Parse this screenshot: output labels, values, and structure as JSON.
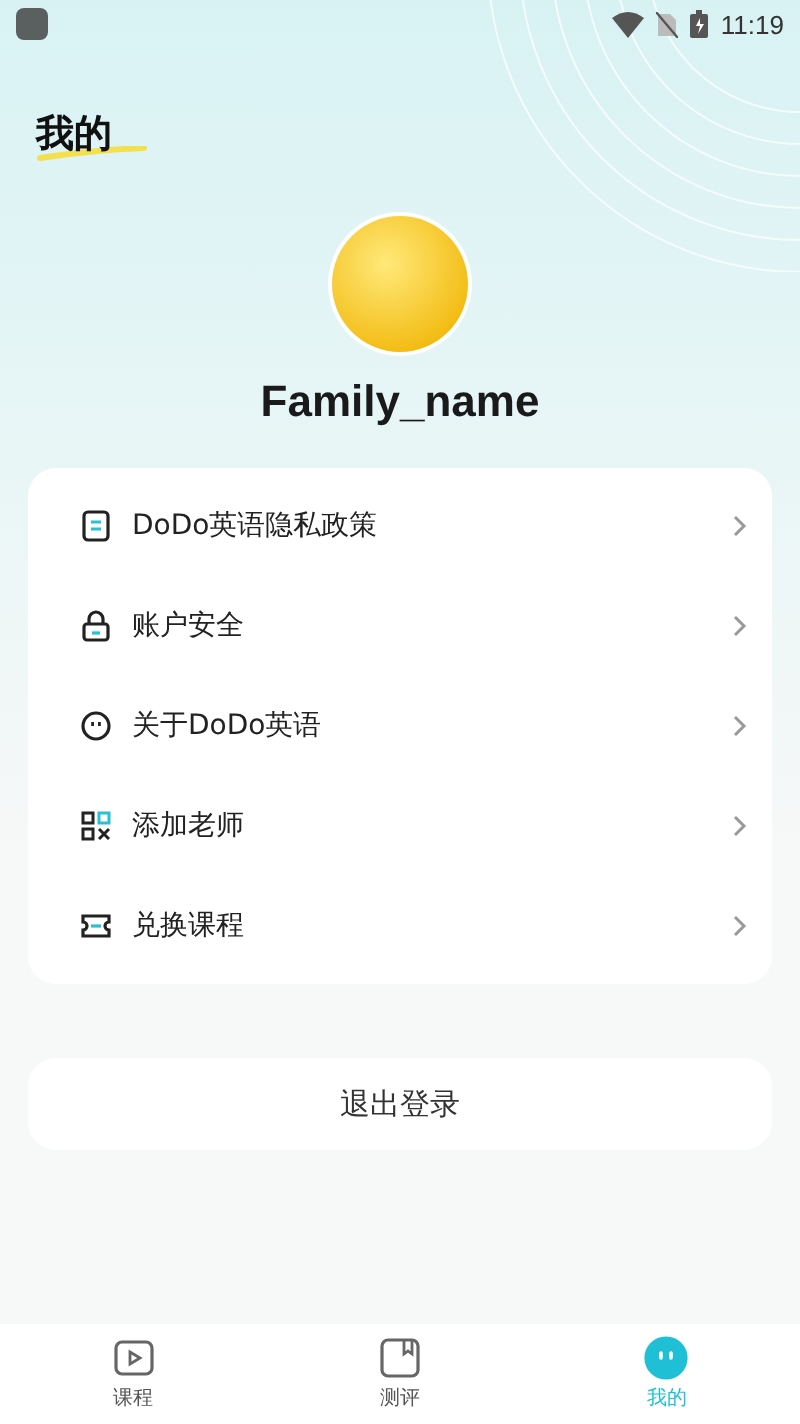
{
  "status_bar": {
    "time": "11:19"
  },
  "title": "我的",
  "profile": {
    "name": "Family_name"
  },
  "menu": [
    {
      "kind": "document",
      "label": "DoDo英语隐私政策"
    },
    {
      "kind": "lock",
      "label": "账户安全"
    },
    {
      "kind": "face",
      "label": "关于DoDo英语"
    },
    {
      "kind": "qr",
      "label": "添加老师"
    },
    {
      "kind": "ticket",
      "label": "兑换课程"
    }
  ],
  "logout_button": "退出登录",
  "tabs": [
    {
      "kind": "video",
      "label": "课程",
      "selected": false
    },
    {
      "kind": "book",
      "label": "测评",
      "selected": false
    },
    {
      "kind": "face",
      "label": "我的",
      "selected": true
    }
  ]
}
